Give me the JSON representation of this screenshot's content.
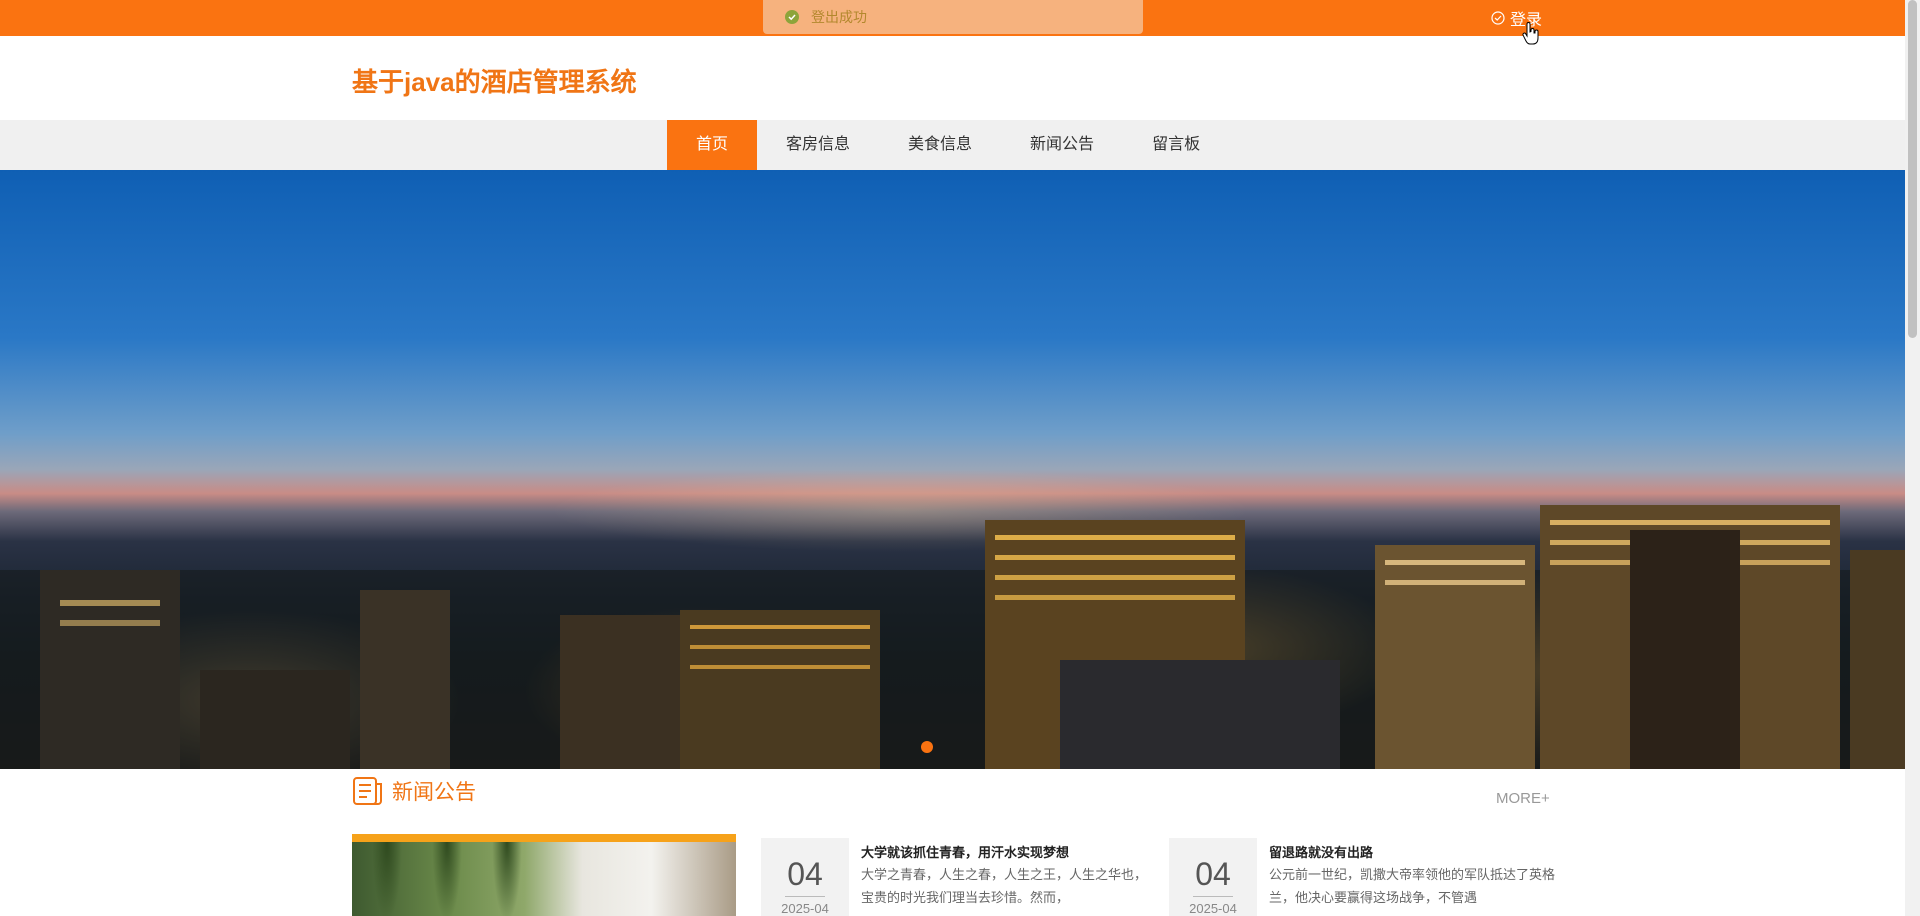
{
  "topbar": {
    "toast_text": "登出成功",
    "login_label": "登录"
  },
  "header": {
    "site_title": "基于java的酒店管理系统"
  },
  "nav": {
    "items": [
      {
        "label": "首页",
        "active": true
      },
      {
        "label": "客房信息",
        "active": false
      },
      {
        "label": "美食信息",
        "active": false
      },
      {
        "label": "新闻公告",
        "active": false
      },
      {
        "label": "留言板",
        "active": false
      }
    ]
  },
  "news": {
    "section_title": "新闻公告",
    "more_label": "MORE+",
    "items": [
      {
        "day": "04",
        "month": "2025-04",
        "title": "大学就该抓住青春，用汗水实现梦想",
        "desc": "大学之青春，人生之春，人生之王，人生之华也，宝贵的时光我们理当去珍惜。然而，"
      },
      {
        "day": "04",
        "month": "2025-04",
        "title": "留退路就没有出路",
        "desc": "公元前一世纪，凯撒大帝率领他的军队抵达了英格兰，他决心要赢得这场战争，不管遇"
      }
    ]
  },
  "colors": {
    "brand": "#fa7311",
    "title": "#f07515"
  }
}
